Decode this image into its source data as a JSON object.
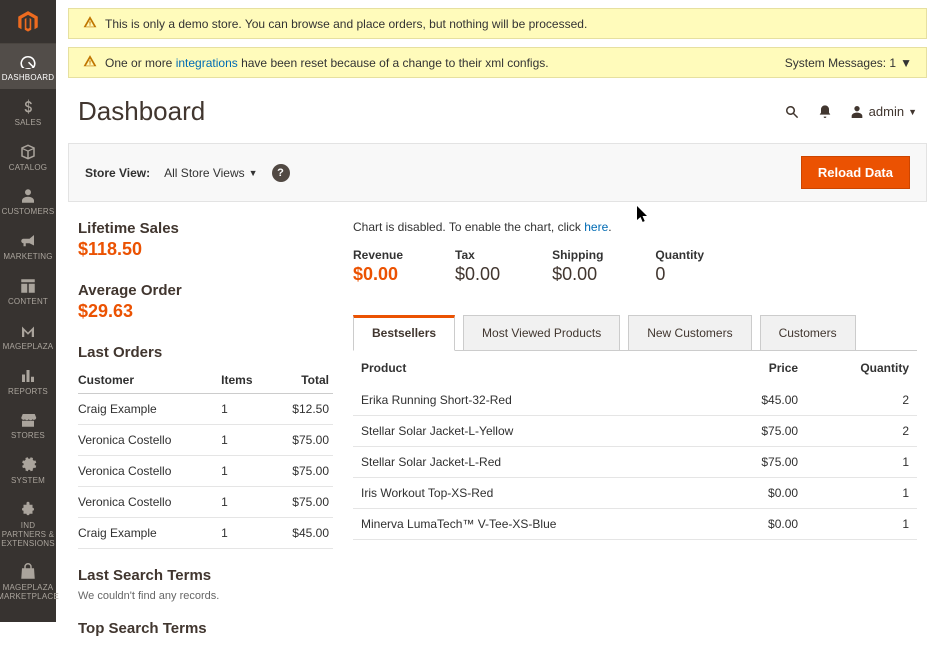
{
  "banners": {
    "demo": "This is only a demo store. You can browse and place orders, but nothing will be processed.",
    "xml_pre": "One or more ",
    "xml_link": "integrations",
    "xml_post": " have been reset because of a change to their xml configs.",
    "sysmsg": "System Messages: 1"
  },
  "nav": {
    "dashboard": "DASHBOARD",
    "sales": "SALES",
    "catalog": "CATALOG",
    "customers": "CUSTOMERS",
    "marketing": "MARKETING",
    "content": "CONTENT",
    "mageplaza": "MAGEPLAZA",
    "reports": "REPORTS",
    "stores": "STORES",
    "system": "SYSTEM",
    "partners": "IND PARTNERS & EXTENSIONS",
    "marketplace": "MAGEPLAZA MARKETPLACE"
  },
  "header": {
    "title": "Dashboard",
    "username": "admin"
  },
  "toolbar": {
    "store_label": "Store View:",
    "store_value": "All Store Views",
    "reload": "Reload Data"
  },
  "stats": {
    "lifetime_label": "Lifetime Sales",
    "lifetime_value": "$118.50",
    "avg_label": "Average Order",
    "avg_value": "$29.63"
  },
  "last_orders": {
    "title": "Last Orders",
    "cols": {
      "customer": "Customer",
      "items": "Items",
      "total": "Total"
    },
    "rows": [
      {
        "customer": "Craig Example",
        "items": "1",
        "total": "$12.50"
      },
      {
        "customer": "Veronica Costello",
        "items": "1",
        "total": "$75.00"
      },
      {
        "customer": "Veronica Costello",
        "items": "1",
        "total": "$75.00"
      },
      {
        "customer": "Veronica Costello",
        "items": "1",
        "total": "$75.00"
      },
      {
        "customer": "Craig Example",
        "items": "1",
        "total": "$45.00"
      }
    ]
  },
  "search": {
    "last_title": "Last Search Terms",
    "last_sub": "We couldn't find any records.",
    "top_title": "Top Search Terms"
  },
  "chart": {
    "note_pre": "Chart is disabled. To enable the chart, click ",
    "note_link": "here",
    "note_post": "."
  },
  "metrics": {
    "revenue_lbl": "Revenue",
    "revenue_val": "$0.00",
    "tax_lbl": "Tax",
    "tax_val": "$0.00",
    "shipping_lbl": "Shipping",
    "shipping_val": "$0.00",
    "quantity_lbl": "Quantity",
    "quantity_val": "0"
  },
  "tabs": {
    "bestsellers": "Bestsellers",
    "most_viewed": "Most Viewed Products",
    "new_customers": "New Customers",
    "customers": "Customers"
  },
  "products": {
    "cols": {
      "product": "Product",
      "price": "Price",
      "quantity": "Quantity"
    },
    "rows": [
      {
        "product": "Erika Running Short-32-Red",
        "price": "$45.00",
        "quantity": "2"
      },
      {
        "product": "Stellar Solar Jacket-L-Yellow",
        "price": "$75.00",
        "quantity": "2"
      },
      {
        "product": "Stellar Solar Jacket-L-Red",
        "price": "$75.00",
        "quantity": "1"
      },
      {
        "product": "Iris Workout Top-XS-Red",
        "price": "$0.00",
        "quantity": "1"
      },
      {
        "product": "Minerva LumaTech™ V-Tee-XS-Blue",
        "price": "$0.00",
        "quantity": "1"
      }
    ]
  }
}
